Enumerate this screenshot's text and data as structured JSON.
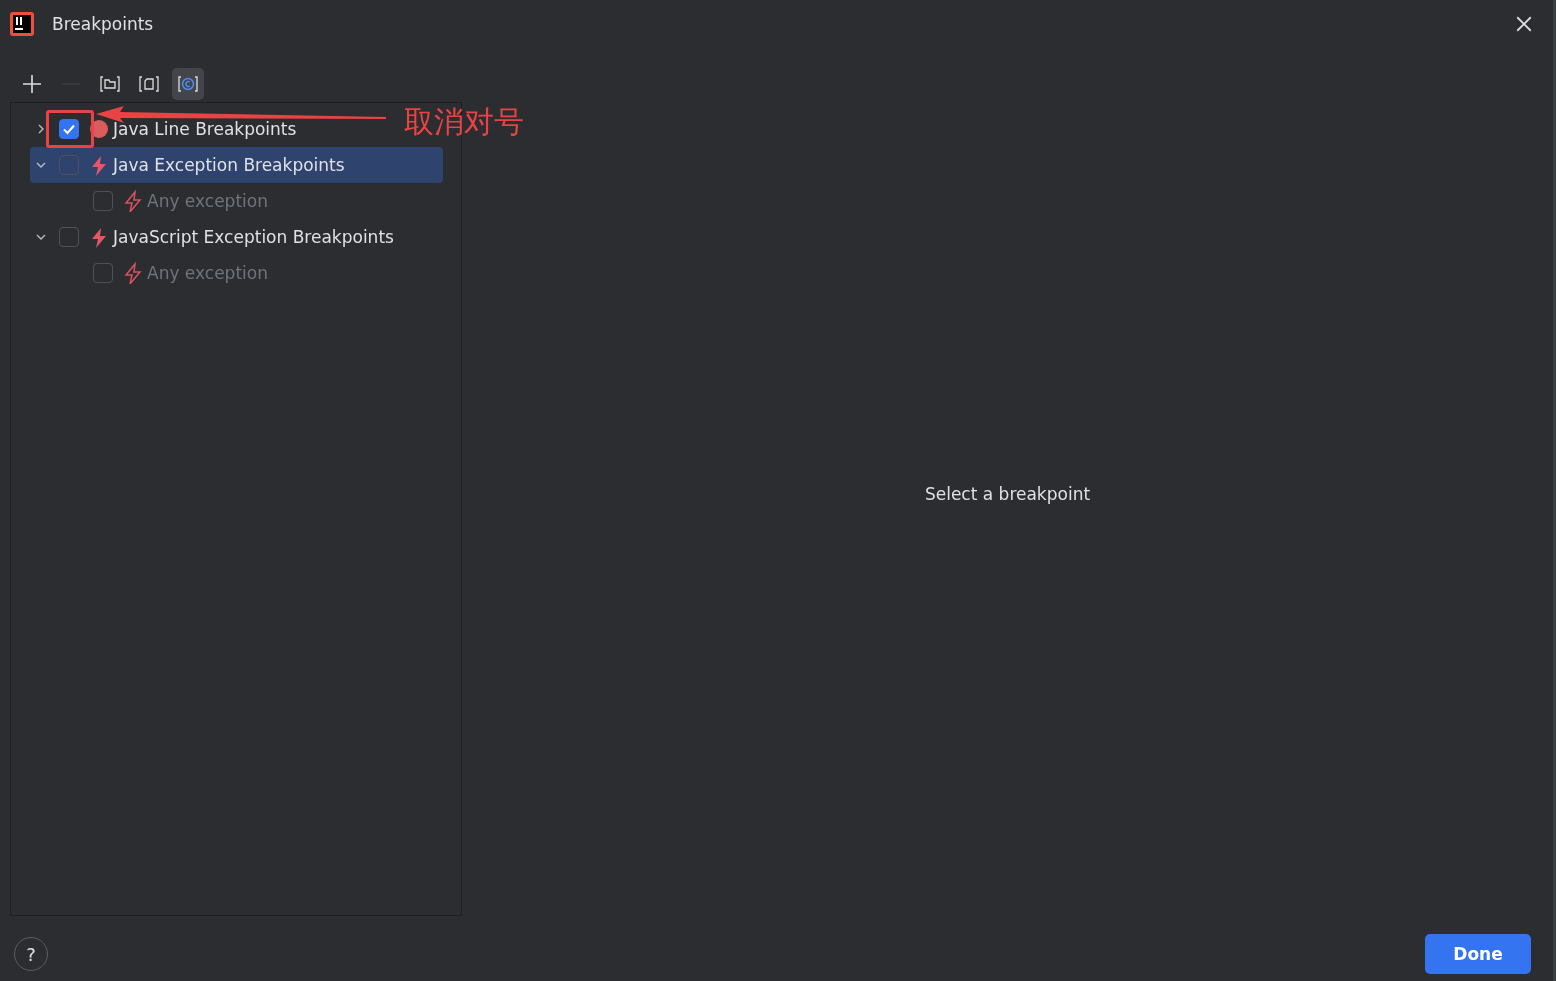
{
  "window": {
    "title": "Breakpoints"
  },
  "toolbar": [
    {
      "kind": "add",
      "disabled": false,
      "selected": false
    },
    {
      "kind": "remove",
      "disabled": true,
      "selected": false
    },
    {
      "kind": "group-folder",
      "disabled": false,
      "selected": false
    },
    {
      "kind": "group-file",
      "disabled": false,
      "selected": false
    },
    {
      "kind": "group-class",
      "disabled": false,
      "selected": true
    }
  ],
  "tree": [
    {
      "label": "Java Line Breakpoints",
      "kind": "line",
      "checked": true,
      "expanded": false,
      "selected": false,
      "disabled": false
    },
    {
      "label": "Java Exception Breakpoints",
      "kind": "exception",
      "checked": false,
      "expanded": true,
      "selected": true,
      "disabled": false,
      "children": [
        {
          "label": "Any exception",
          "kind": "exception",
          "checked": false,
          "selected": false,
          "disabled": true
        }
      ]
    },
    {
      "label": "JavaScript Exception Breakpoints",
      "kind": "exception",
      "checked": false,
      "expanded": true,
      "selected": false,
      "disabled": false,
      "children": [
        {
          "label": "Any exception",
          "kind": "exception",
          "checked": false,
          "selected": false,
          "disabled": true
        }
      ]
    }
  ],
  "detail": {
    "placeholder": "Select a breakpoint"
  },
  "annotation": {
    "text": "取消对号"
  },
  "buttons": {
    "help": "?",
    "done": "Done"
  }
}
